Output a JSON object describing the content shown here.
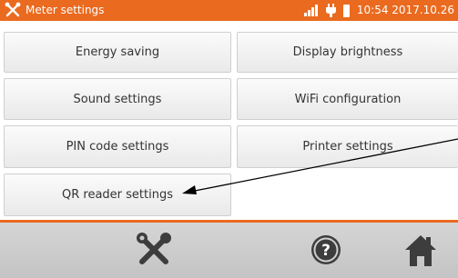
{
  "header": {
    "title": "Meter settings",
    "clock": "10:54 2017.10.26",
    "icons": [
      "tools-icon",
      "signal-icon",
      "plug-icon",
      "battery-icon"
    ]
  },
  "menu": {
    "energy_saving": "Energy saving",
    "display_brightness": "Display brightness",
    "sound_settings": "Sound settings",
    "wifi_configuration": "WiFi configuration",
    "pin_code_settings": "PIN code settings",
    "printer_settings": "Printer settings",
    "qr_reader_settings": "QR reader settings"
  },
  "footer": {
    "icons": [
      "tools-icon",
      "help-icon",
      "home-icon"
    ]
  },
  "colors": {
    "accent": "#ea6a1f",
    "footer": "#c9c9c9"
  }
}
